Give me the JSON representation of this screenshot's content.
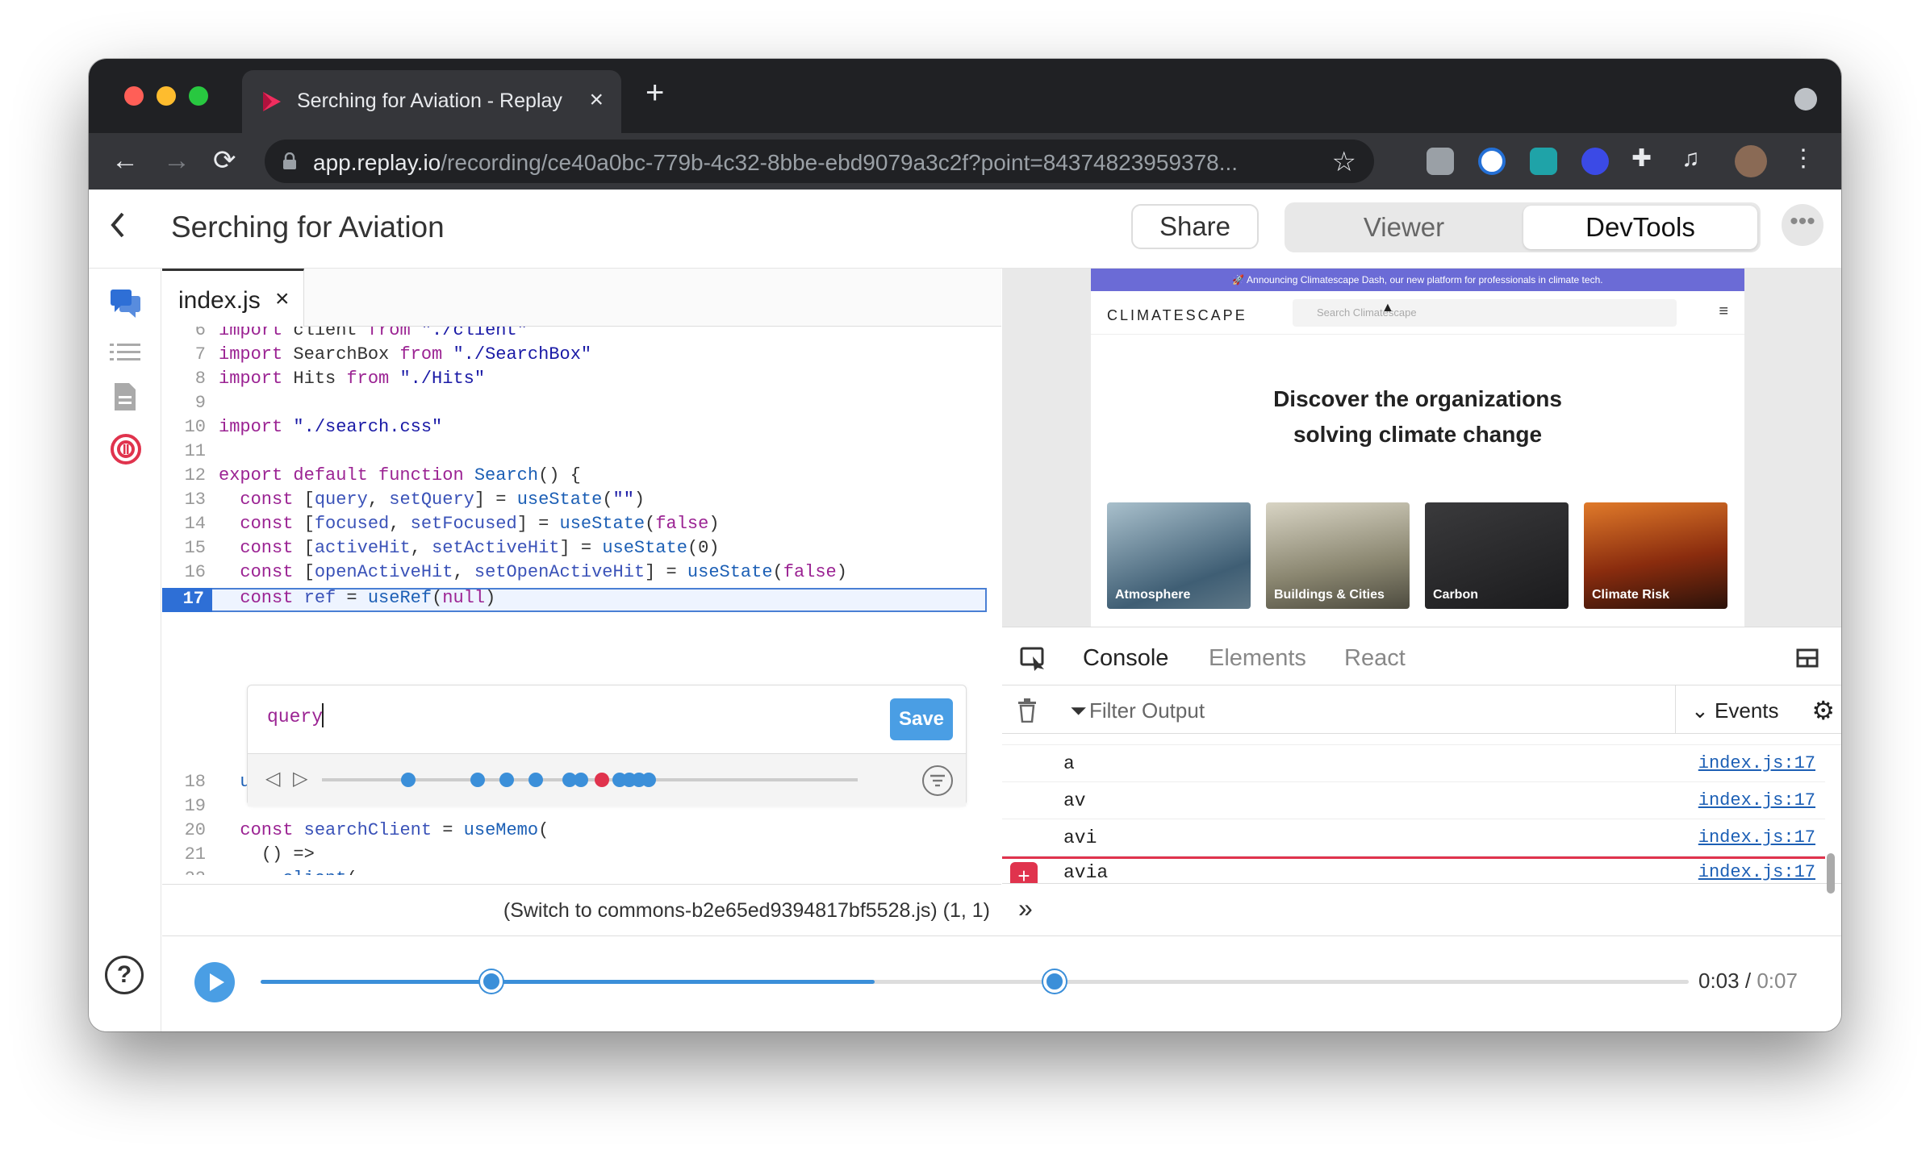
{
  "browser": {
    "tab_title": "Serching for Aviation - Replay",
    "url_host": "app.replay.io",
    "url_path": "/recording/ce40a0bc-779b-4c32-8bbe-ebd9079a3c2f?point=84374823959378..."
  },
  "header": {
    "title": "Serching for Aviation",
    "share_label": "Share",
    "viewer_label": "Viewer",
    "devtools_label": "DevTools",
    "more_label": "•••"
  },
  "editor": {
    "file_tab": "index.js",
    "lines": [
      {
        "n": "6",
        "text": "import client from \"./client\""
      },
      {
        "n": "7",
        "text": "import SearchBox from \"./SearchBox\""
      },
      {
        "n": "8",
        "text": "import Hits from \"./Hits\""
      },
      {
        "n": "9",
        "text": ""
      },
      {
        "n": "10",
        "text": "import \"./search.css\""
      },
      {
        "n": "11",
        "text": ""
      },
      {
        "n": "12",
        "text": "export default function Search() {"
      },
      {
        "n": "13",
        "text": "  const [query, setQuery] = useState(\"\")"
      },
      {
        "n": "14",
        "text": "  const [focused, setFocused] = useState(false)"
      },
      {
        "n": "15",
        "text": "  const [activeHit, setActiveHit] = useState(0)"
      },
      {
        "n": "16",
        "text": "  const [openActiveHit, setOpenActiveHit] = useState(false)"
      },
      {
        "n": "17",
        "text": "  const ref = useRef(null)"
      }
    ],
    "lines_after": [
      {
        "n": "18",
        "text": "  useClickOutside(ref, () => setFocused(false))"
      },
      {
        "n": "19",
        "text": ""
      },
      {
        "n": "20",
        "text": "  const searchClient = useMemo("
      },
      {
        "n": "21",
        "text": "    () =>"
      },
      {
        "n": "22",
        "text": "      client("
      }
    ],
    "log_expression": "query",
    "save_label": "Save",
    "status_text": "(Switch to commons-b2e65ed9394817bf5528.js)  (1, 1)"
  },
  "preview": {
    "announcement": "🚀 Announcing Climatescape Dash, our new platform for professionals in climate tech.",
    "logo": "CLIMATESCAPE",
    "search_placeholder": "Search Climatescape",
    "hero_line1": "Discover the organizations",
    "hero_line2": "solving climate change",
    "cards": [
      "Atmosphere",
      "Buildings & Cities",
      "Carbon",
      "Climate Risk"
    ]
  },
  "console": {
    "tabs": [
      "Console",
      "Elements",
      "React"
    ],
    "filter_placeholder": "Filter Output",
    "events_label": "Events",
    "messages": [
      {
        "value": "a",
        "source": "index.js:17"
      },
      {
        "value": "av",
        "source": "index.js:17"
      },
      {
        "value": "avi",
        "source": "index.js:17"
      },
      {
        "value": "avia",
        "source": "index.js:17"
      }
    ]
  },
  "timeline": {
    "current_time": "0:03",
    "separator": "/",
    "duration": "0:07",
    "progress": 0.43
  },
  "colors": {
    "accent": "#3b8fd9",
    "error": "#e0334d",
    "announce": "#6b6bd6"
  }
}
